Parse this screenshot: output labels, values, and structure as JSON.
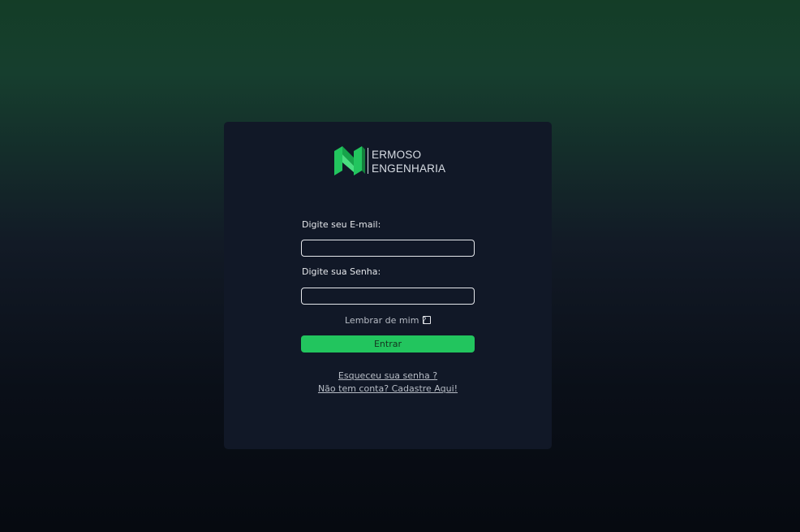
{
  "logo": {
    "line1": "ERMOSO",
    "line2": "ENGENHARIA",
    "icon": "ermoso-logo-mark"
  },
  "form": {
    "email_label": "Digite seu E-mail:",
    "email_value": "",
    "password_label": "Digite sua Senha:",
    "password_value": "",
    "remember_label": "Lembrar de mim ?",
    "remember_checked": false,
    "submit_label": "Entrar"
  },
  "links": {
    "forgot": "Esqueceu sua senha ?",
    "signup": "Não tem conta? Cadastre Aqui!"
  },
  "colors": {
    "accent": "#22c55e",
    "card": "#111827",
    "background_top": "#143d27",
    "background_bottom": "#060a10"
  }
}
